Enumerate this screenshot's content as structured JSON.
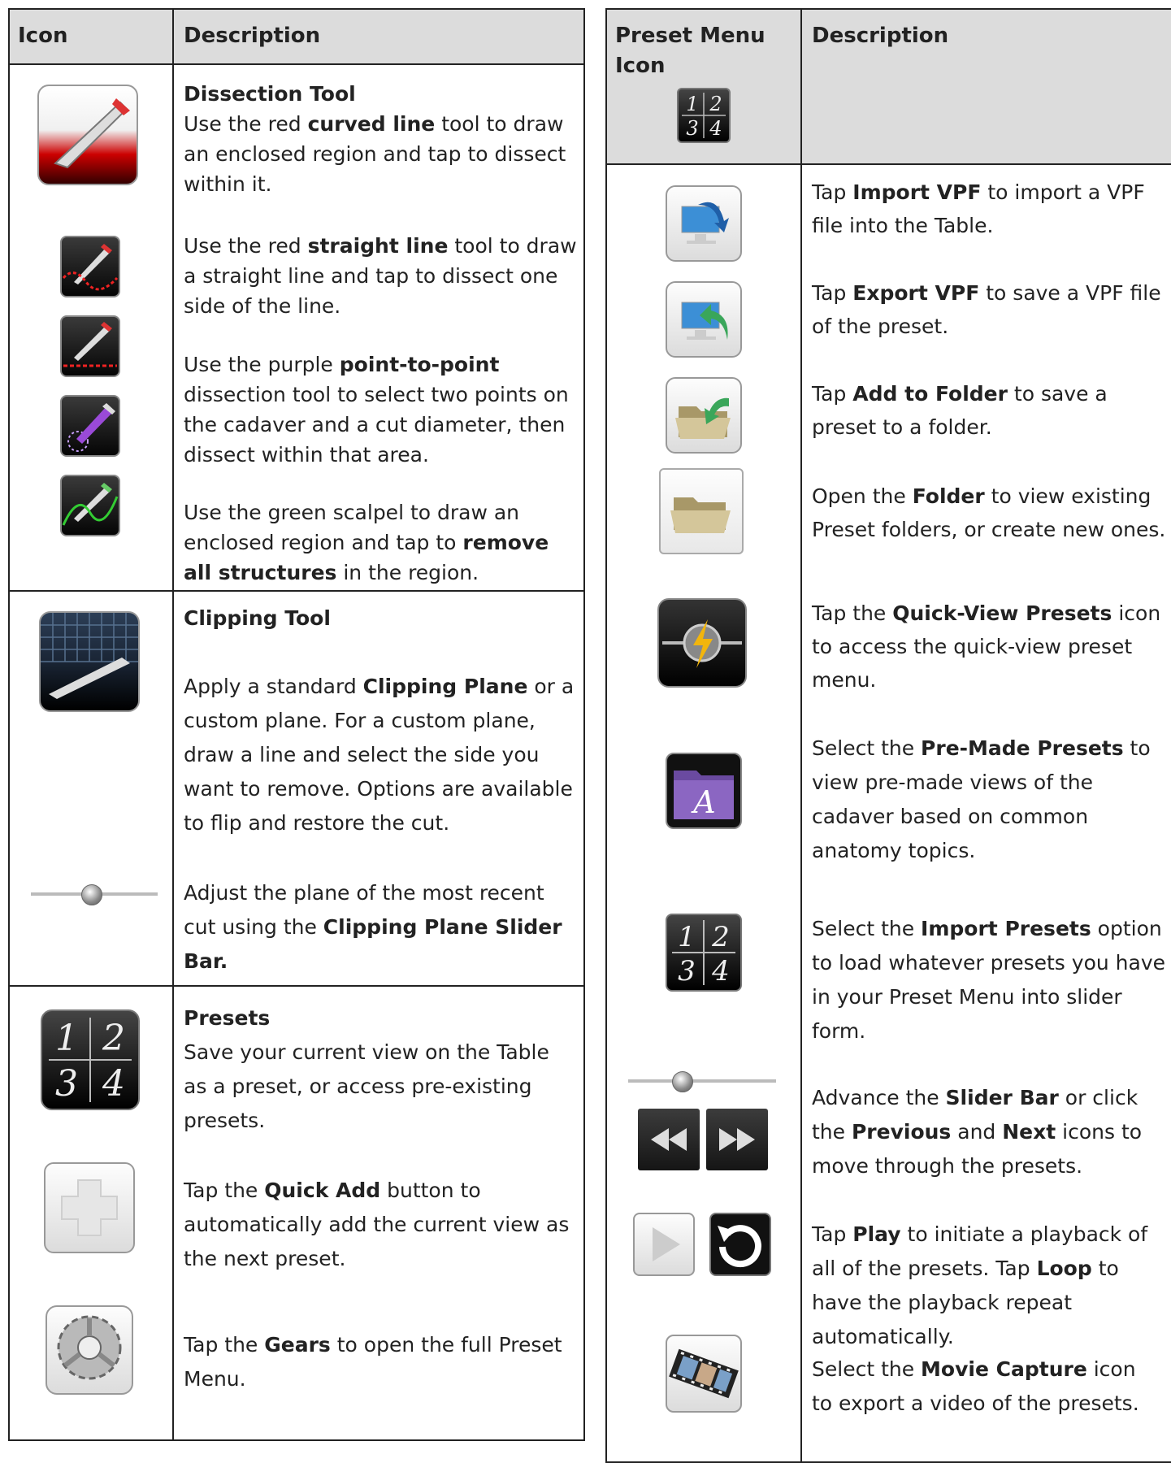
{
  "left": {
    "headers": {
      "icon": "Icon",
      "description": "Description"
    },
    "dissection": {
      "title": "Dissection Tool",
      "p1": [
        "Use the red ",
        "curved line",
        " tool to draw an enclosed region and tap to dissect within it."
      ],
      "p2": [
        "Use the red ",
        "straight line",
        " tool to draw a straight line and tap to dissect one side of the line."
      ],
      "p3": [
        "Use the purple ",
        "point-to-point",
        " dissection tool to select two points on the cadaver and a cut diameter, then dissect within that area."
      ],
      "p4": [
        "Use the green scalpel to draw an enclosed region and tap to ",
        "remove all structures",
        " in the region."
      ]
    },
    "clipping": {
      "title": "Clipping Tool",
      "p1": [
        "Apply a standard ",
        "Clipping Plane",
        " or a custom plane. For a custom plane, draw a line and select the side you want to remove. Options are available to flip and restore the cut."
      ],
      "p2": [
        "Adjust the plane of the most recent cut using the ",
        "Clipping Plane Slider Bar.",
        ""
      ]
    },
    "presets": {
      "title": "Presets",
      "p1": "Save your current view on the Table as a preset, or access pre-existing presets.",
      "p2": [
        "Tap the ",
        "Quick Add",
        " button to automatically add the current view as the next preset."
      ],
      "p3": [
        "Tap the ",
        "Gears",
        " to open the full Preset Menu."
      ],
      "grid": [
        "1",
        "2",
        "3",
        "4"
      ]
    }
  },
  "right": {
    "headers": {
      "icon": "Preset Menu Icon",
      "description": "Description"
    },
    "rows": [
      [
        "Tap ",
        "Import VPF",
        " to import a VPF file into the Table."
      ],
      [
        "Tap ",
        "Export VPF",
        " to save a VPF file of the preset."
      ],
      [
        "Tap ",
        "Add to Folder",
        " to save a preset to a folder."
      ],
      [
        "Open the ",
        "Folder",
        " to view existing Preset folders, or create new ones."
      ],
      [
        "Tap the ",
        "Quick-View Presets",
        " icon to access the quick-view preset menu."
      ],
      [
        "Select the ",
        "Pre-Made Presets",
        " to view pre-made views of the cadaver based on common anatomy topics."
      ],
      [
        "Select the ",
        "Import Presets",
        " option to load whatever presets you have in your Preset Menu into slider form."
      ],
      [
        "Advance the ",
        "Slider Bar",
        " or click the ",
        "Previous",
        " and ",
        "Next",
        " icons to move through the presets."
      ],
      [
        "Tap ",
        "Play",
        " to initiate a playback of all of the presets. Tap ",
        "Loop",
        " to have the playback repeat automatically."
      ],
      [
        "Select the ",
        "Movie Capture",
        " icon to export a video of the presets."
      ]
    ],
    "folder_letter": "A",
    "grid": [
      "1",
      "2",
      "3",
      "4"
    ]
  },
  "colors": {
    "header_bg": "#dcdcdc",
    "border": "#222222",
    "text": "#222222"
  }
}
